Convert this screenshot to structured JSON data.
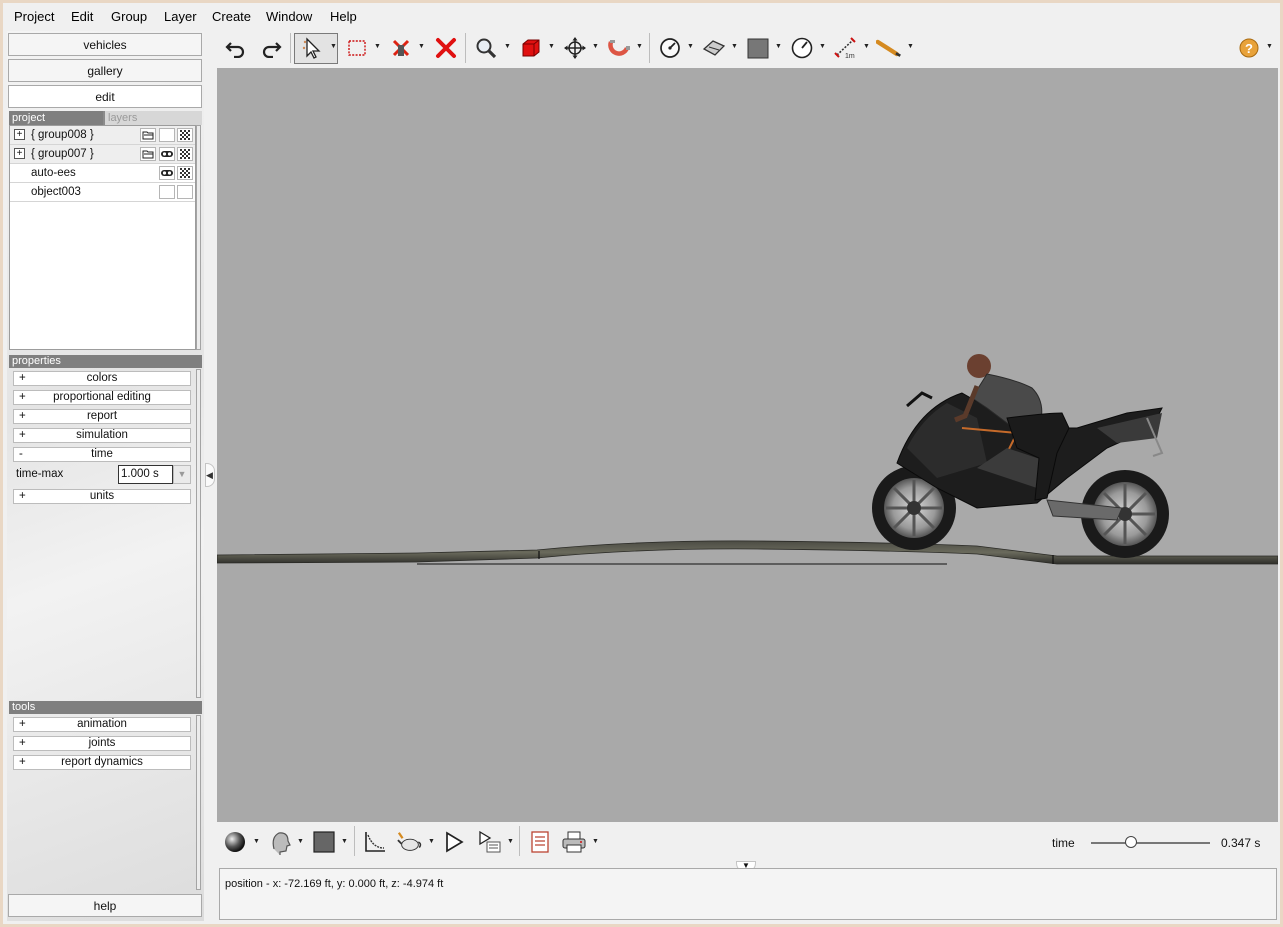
{
  "menu": [
    "Project",
    "Edit",
    "Group",
    "Layer",
    "Create",
    "Window",
    "Help"
  ],
  "side_buttons": {
    "vehicles": "vehicles",
    "gallery": "gallery",
    "edit": "edit",
    "help": "help"
  },
  "project_panel": {
    "tabs": [
      "project",
      "layers"
    ],
    "rows": [
      {
        "label": "{ group008 }",
        "expander": "+"
      },
      {
        "label": "{ group007 }",
        "expander": "+"
      },
      {
        "label": "auto-ees"
      },
      {
        "label": "object003"
      }
    ]
  },
  "properties": {
    "header": "properties",
    "items": [
      {
        "sign": "+",
        "label": "colors"
      },
      {
        "sign": "+",
        "label": "proportional editing"
      },
      {
        "sign": "+",
        "label": "report"
      },
      {
        "sign": "+",
        "label": "simulation"
      },
      {
        "sign": "-",
        "label": "time"
      },
      {
        "sign": "+",
        "label": "units"
      }
    ],
    "time_max": {
      "label": "time-max",
      "value": "1.000 s"
    }
  },
  "tools": {
    "header": "tools",
    "items": [
      {
        "sign": "+",
        "label": "animation"
      },
      {
        "sign": "+",
        "label": "joints"
      },
      {
        "sign": "+",
        "label": "report dynamics"
      }
    ]
  },
  "toolbar_icons": [
    "undo-icon",
    "redo-icon",
    "select-arrow-icon",
    "rectangle-select-icon",
    "delete-marker-icon",
    "delete-icon",
    "zoom-icon",
    "cube-icon",
    "move-icon",
    "magnet-icon",
    "clock-icon",
    "surface-icon",
    "square-icon",
    "dial-icon",
    "measure-icon",
    "pen-icon",
    "help-icon"
  ],
  "time": {
    "label": "time",
    "value": "0.347 s",
    "fraction": 0.347
  },
  "status": {
    "text": "position - x: -72.169 ft, y: 0.000 ft, z: -4.974 ft"
  },
  "colors": {
    "viewport": "#a9a9a9",
    "menu_bg": "#f0f0f0",
    "header_bg": "#7f7f7f",
    "delete_red": "#e01010"
  }
}
